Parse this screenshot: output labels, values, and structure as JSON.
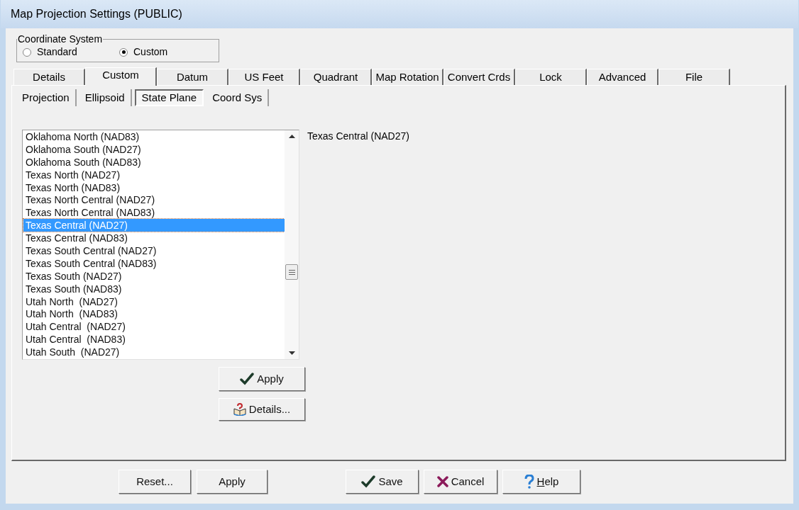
{
  "window": {
    "title": "Map Projection Settings (PUBLIC)"
  },
  "coordinate_system": {
    "legend": "Coordinate System",
    "options": [
      {
        "label": "Standard",
        "selected": false
      },
      {
        "label": "Custom",
        "selected": true
      }
    ]
  },
  "tabs": [
    {
      "label": "Details",
      "selected": false
    },
    {
      "label": "Custom",
      "selected": true
    },
    {
      "label": "Datum",
      "selected": false
    },
    {
      "label": "US Feet",
      "selected": false
    },
    {
      "label": "Quadrant",
      "selected": false
    },
    {
      "label": "Map Rotation",
      "selected": false
    },
    {
      "label": "Convert Crds",
      "selected": false
    },
    {
      "label": "Lock",
      "selected": false
    },
    {
      "label": "Advanced",
      "selected": false
    },
    {
      "label": "File",
      "selected": false
    }
  ],
  "subtabs": [
    {
      "label": "Projection",
      "selected": false
    },
    {
      "label": "Ellipsoid",
      "selected": false
    },
    {
      "label": "State Plane",
      "selected": true
    },
    {
      "label": "Coord Sys",
      "selected": false
    }
  ],
  "zones": [
    {
      "label": "Oklahoma North (NAD83)",
      "selected": false
    },
    {
      "label": "Oklahoma South (NAD27)",
      "selected": false
    },
    {
      "label": "Oklahoma South (NAD83)",
      "selected": false
    },
    {
      "label": "Texas North (NAD27)",
      "selected": false
    },
    {
      "label": "Texas North (NAD83)",
      "selected": false
    },
    {
      "label": "Texas North Central (NAD27)",
      "selected": false
    },
    {
      "label": "Texas North Central (NAD83)",
      "selected": false
    },
    {
      "label": "Texas Central (NAD27)",
      "selected": true
    },
    {
      "label": "Texas Central (NAD83)",
      "selected": false
    },
    {
      "label": "Texas South Central (NAD27)",
      "selected": false
    },
    {
      "label": "Texas South Central (NAD83)",
      "selected": false
    },
    {
      "label": "Texas South (NAD27)",
      "selected": false
    },
    {
      "label": "Texas South (NAD83)",
      "selected": false
    },
    {
      "label": "Utah North  (NAD27)",
      "selected": false
    },
    {
      "label": "Utah North  (NAD83)",
      "selected": false
    },
    {
      "label": "Utah Central  (NAD27)",
      "selected": false
    },
    {
      "label": "Utah Central  (NAD83)",
      "selected": false
    },
    {
      "label": "Utah South  (NAD27)",
      "selected": false
    }
  ],
  "selected_zone": "Texas Central (NAD27)",
  "panel_buttons": [
    {
      "kind": "apply",
      "label": "Apply"
    },
    {
      "kind": "details",
      "label": "Details..."
    }
  ],
  "footer_buttons": [
    {
      "kind": "plain",
      "label": "Reset..."
    },
    {
      "kind": "plain",
      "label": "Apply"
    },
    {
      "kind": "save",
      "label": "Save"
    },
    {
      "kind": "cancel",
      "label": "Cancel"
    },
    {
      "kind": "help",
      "label": "Help"
    }
  ]
}
